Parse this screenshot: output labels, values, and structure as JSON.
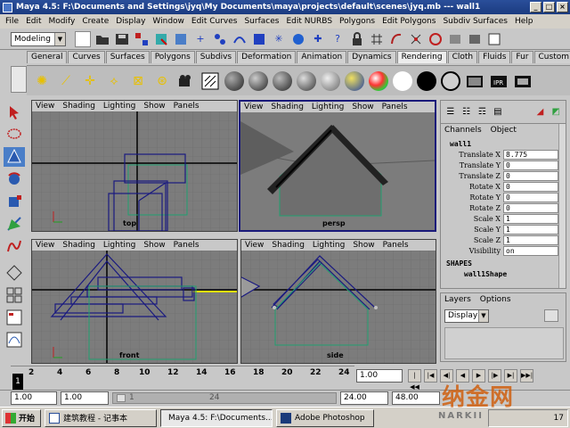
{
  "window": {
    "title": "Maya 4.5: F:\\Documents and Settings\\jyq\\My Documents\\maya\\projects\\default\\scenes\\jyq.mb   ---   wall1",
    "min": "_",
    "max": "□",
    "close": "×"
  },
  "menu": [
    "File",
    "Edit",
    "Modify",
    "Create",
    "Display",
    "Window",
    "Edit Curves",
    "Surfaces",
    "Edit NURBS",
    "Polygons",
    "Edit Polygons",
    "Subdiv Surfaces",
    "Help"
  ],
  "status_line": {
    "mode": "Modeling"
  },
  "shelf_tabs": [
    "General",
    "Curves",
    "Surfaces",
    "Polygons",
    "Subdivs",
    "Deformation",
    "Animation",
    "Dynamics",
    "Rendering",
    "Cloth",
    "Fluids",
    "Fur",
    "Custom"
  ],
  "active_shelf": "Rendering",
  "viewport_menu": [
    "View",
    "Shading",
    "Lighting",
    "Show",
    "Panels"
  ],
  "viewports": {
    "top": {
      "label": "top"
    },
    "persp": {
      "label": "persp"
    },
    "front": {
      "label": "front"
    },
    "side": {
      "label": "side"
    }
  },
  "channel_box": {
    "tabs": [
      "Channels",
      "Object"
    ],
    "object_name": "wall1",
    "channels": [
      {
        "name": "Translate X",
        "value": "8.775"
      },
      {
        "name": "Translate Y",
        "value": "0"
      },
      {
        "name": "Translate Z",
        "value": "0"
      },
      {
        "name": "Rotate X",
        "value": "0"
      },
      {
        "name": "Rotate Y",
        "value": "0"
      },
      {
        "name": "Rotate Z",
        "value": "0"
      },
      {
        "name": "Scale X",
        "value": "1"
      },
      {
        "name": "Scale Y",
        "value": "1"
      },
      {
        "name": "Scale Z",
        "value": "1"
      },
      {
        "name": "Visibility",
        "value": "on"
      }
    ],
    "shapes_header": "SHAPES",
    "shape_name": "wall1Shape"
  },
  "layers": {
    "tabs": [
      "Layers",
      "Options"
    ],
    "display": "Display"
  },
  "time_slider": {
    "ticks": [
      "2",
      "4",
      "6",
      "8",
      "10",
      "12",
      "14",
      "16",
      "18",
      "20",
      "22",
      "24"
    ],
    "current_frame": "1",
    "frame_field": "1.00"
  },
  "range": {
    "start": "1.00",
    "start2": "1.00",
    "slider_start": "1",
    "slider_end": "24",
    "end": "24.00",
    "end2": "48.00"
  },
  "taskbar": {
    "start": "开始",
    "tasks": [
      "建筑教程 - 记事本",
      "Maya 4.5: F:\\Documents...",
      "Adobe Photoshop"
    ],
    "clock": "17"
  },
  "watermark": {
    "brand": "纳金网",
    "sub": "NARKII"
  }
}
